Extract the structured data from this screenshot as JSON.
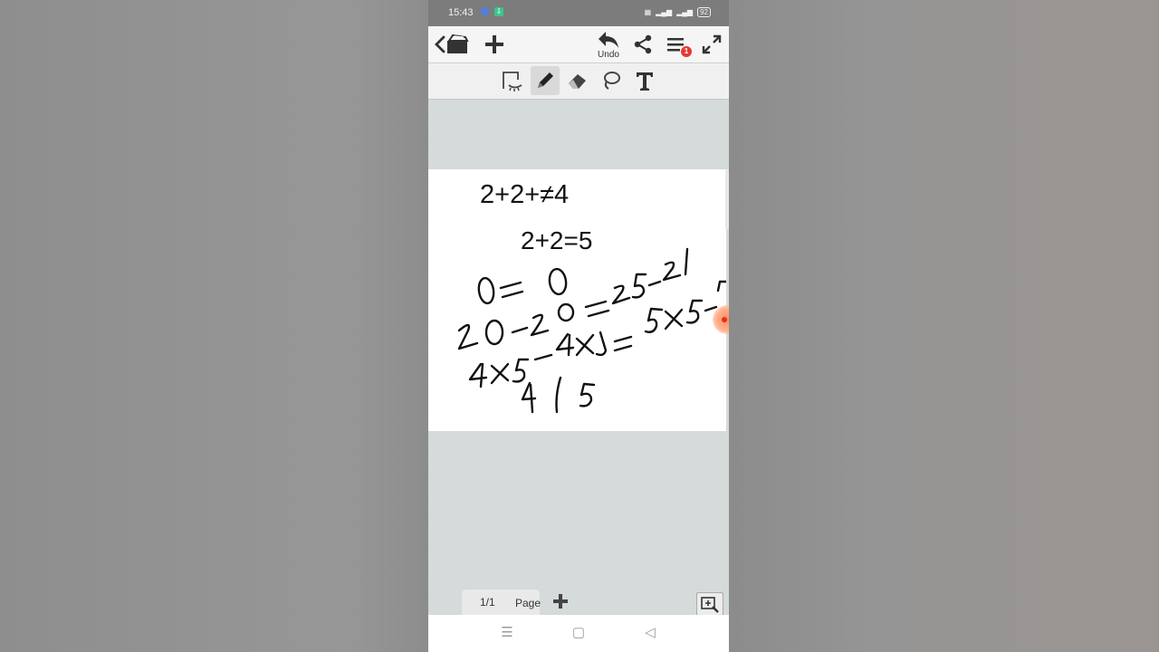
{
  "statusbar": {
    "time": "15:43",
    "battery": "92"
  },
  "toolbar": {
    "undo_label": "Undo",
    "menu_badge": "1"
  },
  "tools": [
    "select-tool",
    "pen-tool",
    "eraser-tool",
    "lasso-tool",
    "text-tool"
  ],
  "canvas": {
    "typed_line_1": "2+2+≠4",
    "typed_line_2": "2+2=5"
  },
  "pagebar": {
    "page_number": "1/1",
    "page_label": "Page"
  },
  "colors": {
    "toolbar_bg": "#f5f5f5",
    "canvas_bg": "#ffffff",
    "workspace_bg": "#d5dadb",
    "pen_accent": "#ff8a5c",
    "badge": "#e53935"
  }
}
